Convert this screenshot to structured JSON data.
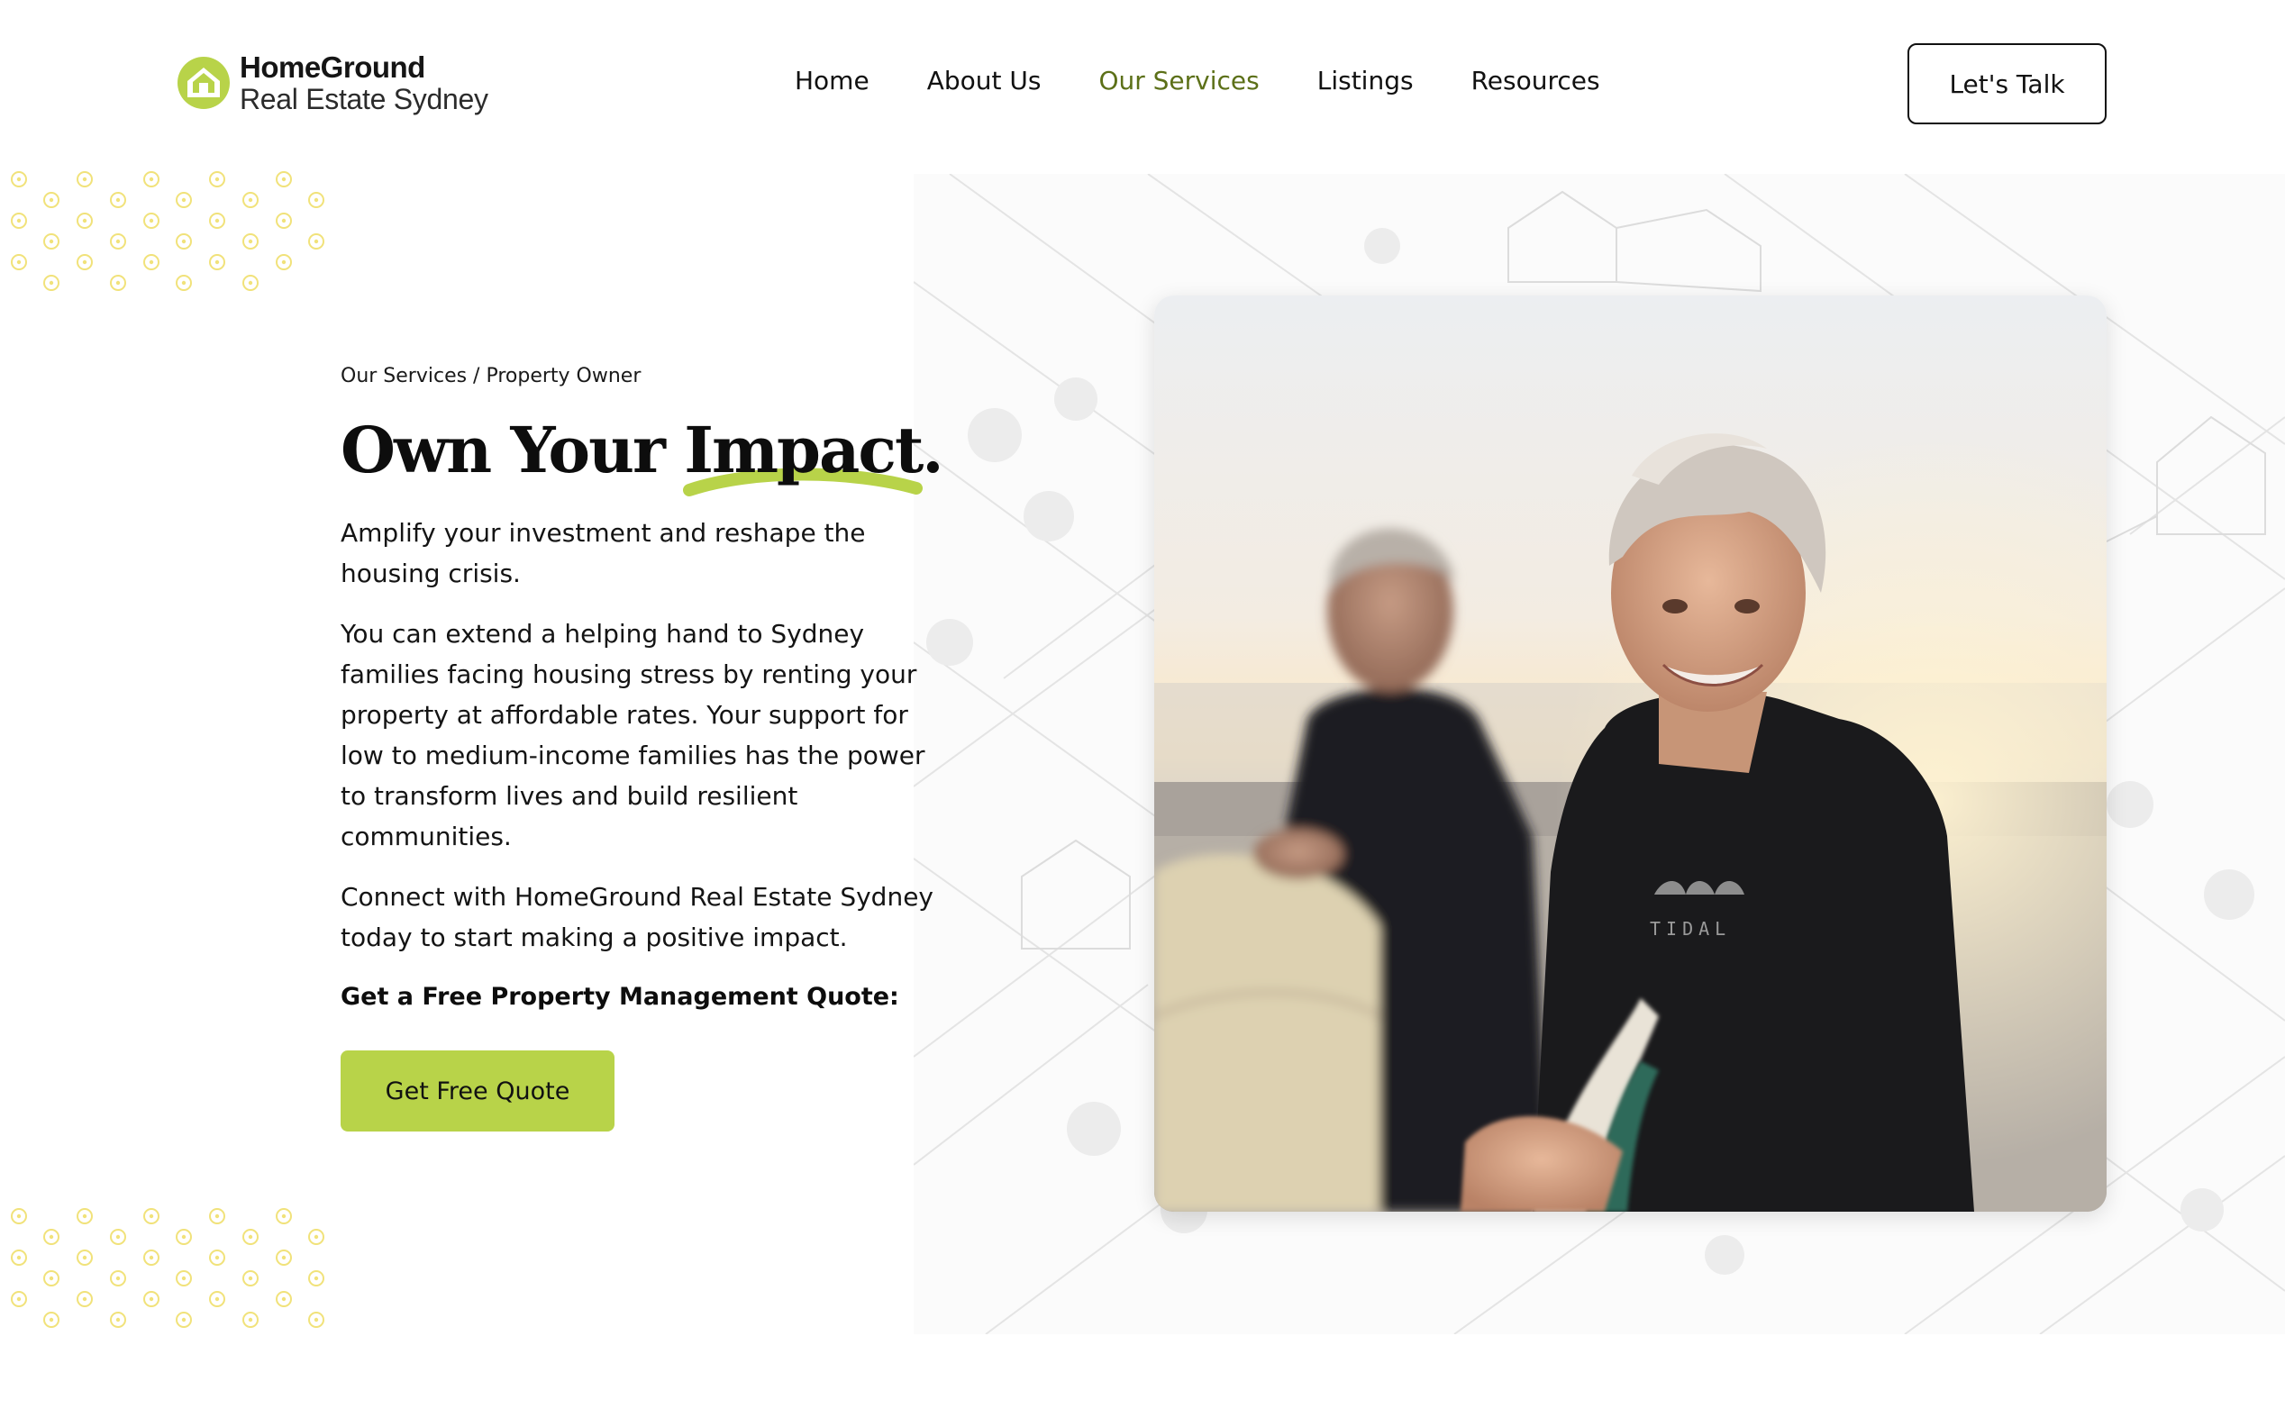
{
  "brand": {
    "name": "HomeGround",
    "sub": "Real Estate Sydney",
    "accent_color": "#b8d349",
    "nav_active_color": "#5c7018"
  },
  "nav": {
    "items": [
      {
        "label": "Home",
        "active": false
      },
      {
        "label": "About Us",
        "active": false
      },
      {
        "label": "Our Services",
        "active": true
      },
      {
        "label": "Listings",
        "active": false
      },
      {
        "label": "Resources",
        "active": false
      }
    ],
    "cta_label": "Let's Talk"
  },
  "hero": {
    "breadcrumb": "Our Services / Property Owner",
    "headline_main": "Own Your ",
    "headline_accent": "Impact.",
    "paragraph_1": "Amplify your investment and reshape the housing crisis.",
    "paragraph_2": "You can extend a helping hand to Sydney families facing housing stress by renting your property at affordable rates. Your support for low to medium-income families has the power to transform lives and build resilient communities.",
    "paragraph_3": "Connect with HomeGround Real Estate Sydney today to start making a positive impact.",
    "quote_lead": "Get a Free Property Management Quote:",
    "quote_button": "Get Free Quote"
  },
  "photo": {
    "subject": "older-couple-surfers-photo",
    "wetsuit_text": "TIDAL"
  },
  "icons": [
    "home-logo-icon",
    "dot-pattern"
  ]
}
